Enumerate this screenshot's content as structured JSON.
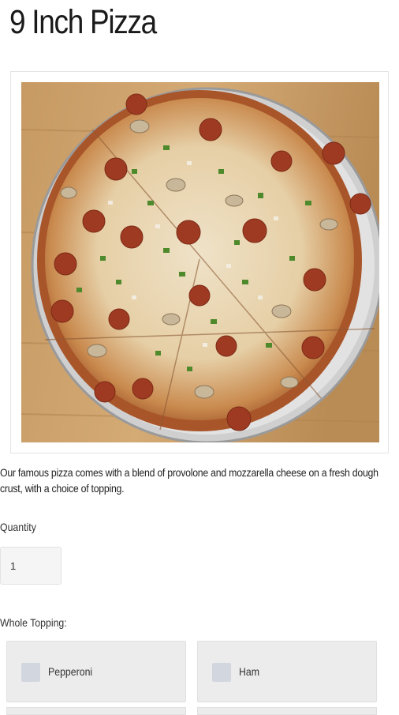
{
  "product": {
    "title": "9 Inch Pizza",
    "image_alt": "pizza-photo",
    "description": "Our famous pizza comes with a blend of provolone and mozzarella cheese on a fresh dough crust, with a choice of topping."
  },
  "quantity": {
    "label": "Quantity",
    "value": "1"
  },
  "toppings": {
    "label": "Whole Topping:",
    "options": [
      {
        "label": "Pepperoni",
        "checked": false
      },
      {
        "label": "Ham",
        "checked": false
      }
    ]
  },
  "colors": {
    "option_bg": "#ececec",
    "checkbox": "#d2d6df",
    "text": "#222222"
  }
}
